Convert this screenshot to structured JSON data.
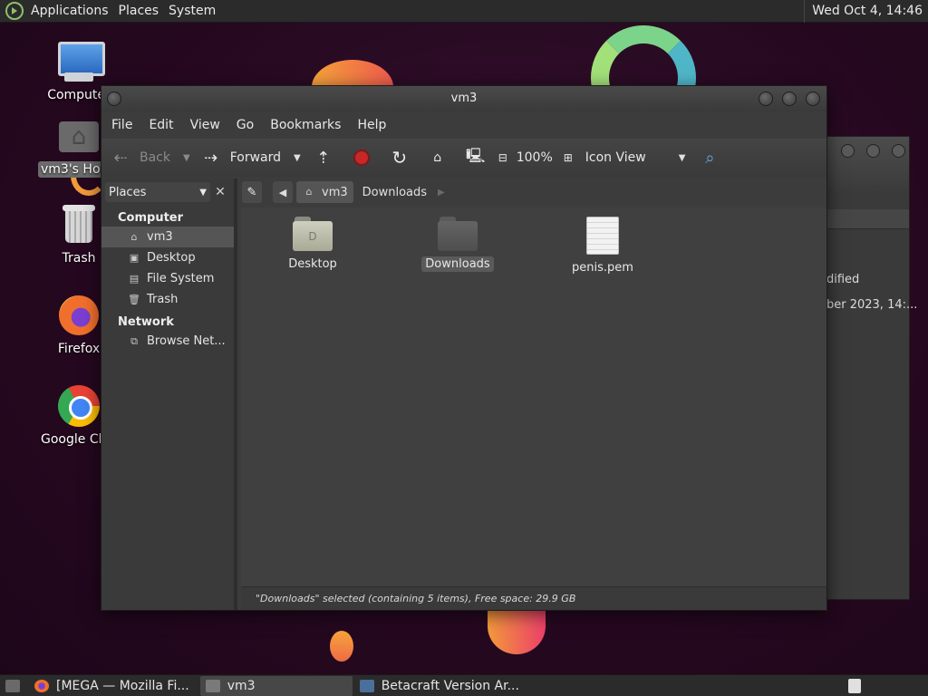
{
  "top_panel": {
    "menus": [
      "Applications",
      "Places",
      "System"
    ],
    "clock": "Wed Oct  4, 14:46"
  },
  "desktop_icons": [
    {
      "label": "Computer"
    },
    {
      "label": "vm3's Home"
    },
    {
      "label": "Trash"
    },
    {
      "label": "Firefox"
    },
    {
      "label": "Google Chrome"
    }
  ],
  "background_window": {
    "column_header": "dified",
    "row_date": "ber 2023, 14:..."
  },
  "window": {
    "title": "vm3",
    "menus": [
      "File",
      "Edit",
      "View",
      "Go",
      "Bookmarks",
      "Help"
    ],
    "toolbar": {
      "back": "Back",
      "forward": "Forward",
      "zoom": "100%",
      "view_mode": "Icon View"
    },
    "sidebar": {
      "selector": "Places",
      "sections": [
        {
          "title": "Computer",
          "items": [
            "vm3",
            "Desktop",
            "File System",
            "Trash"
          ]
        },
        {
          "title": "Network",
          "items": [
            "Browse Net..."
          ]
        }
      ]
    },
    "path": [
      "vm3",
      "Downloads"
    ],
    "files": [
      {
        "name": "Desktop",
        "type": "folder"
      },
      {
        "name": "Downloads",
        "type": "folder"
      },
      {
        "name": "penis.pem",
        "type": "document"
      }
    ],
    "status": "\"Downloads\" selected (containing 5 items), Free space: 29.9 GB"
  },
  "taskbar": {
    "tasks": [
      "[MEGA — Mozilla Fi...",
      "vm3",
      "Betacraft Version Ar..."
    ]
  }
}
